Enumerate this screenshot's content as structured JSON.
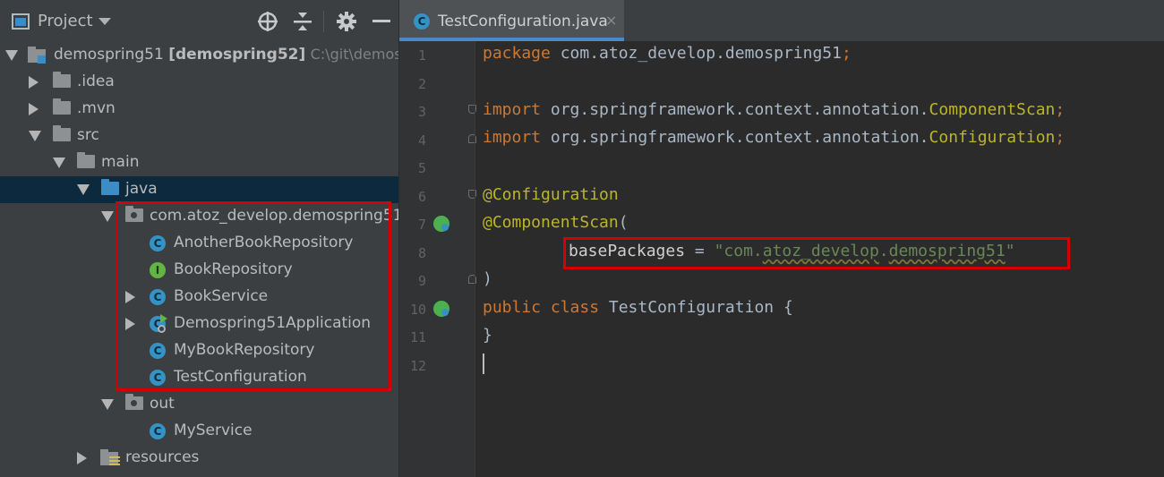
{
  "panel": {
    "title": "Project",
    "tree": [
      {
        "label": "demospring51",
        "bold": "[demospring52]",
        "path": "C:\\git\\demos",
        "kind": "module",
        "expanded": true
      },
      {
        "label": ".idea",
        "kind": "folder",
        "expanded": false
      },
      {
        "label": ".mvn",
        "kind": "folder",
        "expanded": false
      },
      {
        "label": "src",
        "kind": "folder",
        "expanded": true
      },
      {
        "label": "main",
        "kind": "folder",
        "expanded": true
      },
      {
        "label": "java",
        "kind": "source-folder",
        "expanded": true,
        "selected": true
      },
      {
        "label": "com.atoz_develop.demospring51",
        "kind": "package",
        "expanded": true
      },
      {
        "label": "AnotherBookRepository",
        "kind": "class"
      },
      {
        "label": "BookRepository",
        "kind": "interface"
      },
      {
        "label": "BookService",
        "kind": "class",
        "expanded": false
      },
      {
        "label": "Demospring51Application",
        "kind": "spring-app",
        "expanded": false
      },
      {
        "label": "MyBookRepository",
        "kind": "class"
      },
      {
        "label": "TestConfiguration",
        "kind": "class"
      },
      {
        "label": "out",
        "kind": "package",
        "expanded": true
      },
      {
        "label": "MyService",
        "kind": "class"
      },
      {
        "label": "resources",
        "kind": "resources-folder",
        "expanded": false
      }
    ]
  },
  "editor": {
    "tab": {
      "label": "TestConfiguration.java",
      "close": "×"
    },
    "line_numbers": [
      "1",
      "2",
      "3",
      "4",
      "5",
      "6",
      "7",
      "8",
      "9",
      "10",
      "11",
      "12"
    ],
    "lines": [
      {
        "kw": "package",
        "rest": " com.atoz_develop.demospring51",
        "end": ";"
      },
      {},
      {
        "kw": "import",
        "rest": " org.springframework.context.annotation.",
        "cls": "ComponentScan",
        "end": ";"
      },
      {
        "kw": "import",
        "rest": " org.springframework.context.annotation.",
        "cls": "Configuration",
        "end": ";"
      },
      {},
      {
        "ann": "@Configuration"
      },
      {
        "ann": "@ComponentScan",
        "rest": "("
      },
      {
        "attr": "basePackages",
        "eq": " = ",
        "str_open": "\"com.",
        "str_typo1": "atoz_develop",
        "str_dot": ".",
        "str_typo2": "demospring51",
        "str_close": "\""
      },
      {
        "rest": ")"
      },
      {
        "kw": "public class",
        "rest": " TestConfiguration {"
      },
      {
        "rest": "}"
      },
      {}
    ]
  },
  "colors": {
    "panel_bg": "#3c3f41",
    "editor_bg": "#2b2b2b",
    "keyword": "#cc7832",
    "annotation": "#bbb529",
    "string": "#6a8759",
    "highlight": "#d40000",
    "selection": "#0d293e"
  }
}
